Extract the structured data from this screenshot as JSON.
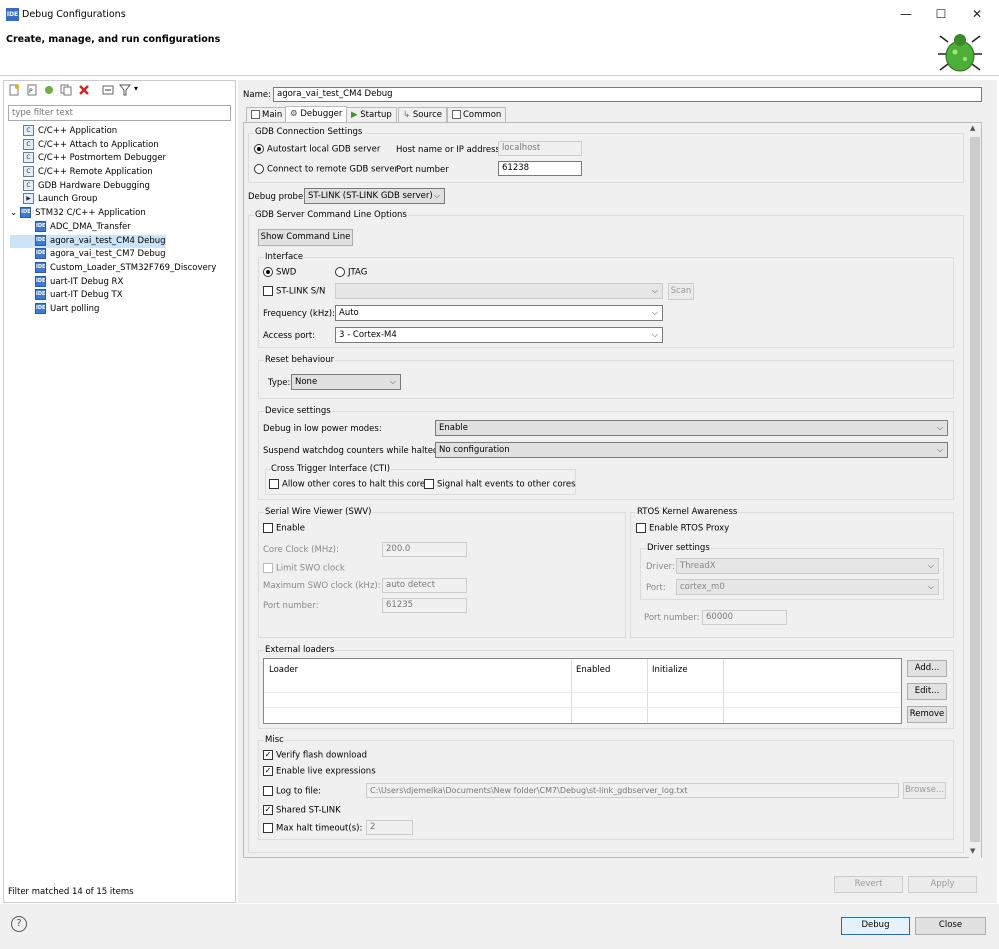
{
  "window": {
    "title": "Debug Configurations",
    "minimize": "—",
    "maximize": "☐",
    "close": "✕"
  },
  "header": {
    "title": "Create, manage, and run configurations"
  },
  "left": {
    "filter_placeholder": "type filter text",
    "tree": [
      {
        "label": "C/C++ Application",
        "level": 1,
        "icon": "c"
      },
      {
        "label": "C/C++ Attach to Application",
        "level": 1,
        "icon": "c"
      },
      {
        "label": "C/C++ Postmortem Debugger",
        "level": 1,
        "icon": "c"
      },
      {
        "label": "C/C++ Remote Application",
        "level": 1,
        "icon": "c"
      },
      {
        "label": "GDB Hardware Debugging",
        "level": 1,
        "icon": "c"
      },
      {
        "label": "Launch Group",
        "level": 1,
        "icon": "launch"
      },
      {
        "label": "STM32 C/C++ Application",
        "level": 0,
        "icon": "ide"
      },
      {
        "label": "ADC_DMA_Transfer",
        "level": 2,
        "icon": "ide"
      },
      {
        "label": "agora_vai_test_CM4 Debug",
        "level": 2,
        "icon": "ide"
      },
      {
        "label": "agora_vai_test_CM7 Debug",
        "level": 2,
        "icon": "ide"
      },
      {
        "label": "Custom_Loader_STM32F769_Discovery",
        "level": 2,
        "icon": "ide"
      },
      {
        "label": "uart-IT Debug RX",
        "level": 2,
        "icon": "ide"
      },
      {
        "label": "uart-IT Debug TX",
        "level": 2,
        "icon": "ide"
      },
      {
        "label": "Uart polling",
        "level": 2,
        "icon": "ide"
      }
    ],
    "status": "Filter matched 14 of 15 items"
  },
  "name_label": "Name:",
  "name_value": "agora_vai_test_CM4 Debug",
  "tabs": [
    "Main",
    "Debugger",
    "Startup",
    "Source",
    "Common"
  ],
  "gdb": {
    "group": "GDB Connection Settings",
    "autostart": "Autostart local GDB server",
    "remote": "Connect to remote GDB server",
    "host_label": "Host name or IP address",
    "host_value": "localhost",
    "port_label": "Port number",
    "port_value": "61238"
  },
  "probe": {
    "label": "Debug probe",
    "value": "ST-LINK (ST-LINK GDB server)"
  },
  "server": {
    "group": "GDB Server Command Line Options",
    "show_cmd": "Show Command Line"
  },
  "interface": {
    "group": "Interface",
    "swd": "SWD",
    "jtag": "JTAG",
    "stlink_sn": "ST-LINK S/N",
    "scan": "Scan",
    "freq_label": "Frequency (kHz):",
    "freq_value": "Auto",
    "access_label": "Access port:",
    "access_value": "3 - Cortex-M4"
  },
  "reset": {
    "group": "Reset behaviour",
    "type_label": "Type:",
    "type_value": "None"
  },
  "device": {
    "group": "Device settings",
    "lowpower_label": "Debug in low power modes:",
    "lowpower_value": "Enable",
    "watchdog_label": "Suspend watchdog counters while halted:",
    "watchdog_value": "No configuration",
    "cti_group": "Cross Trigger Interface (CTI)",
    "cti_allow": "Allow other cores to halt this core",
    "cti_signal": "Signal halt events to other cores"
  },
  "swv": {
    "group": "Serial Wire Viewer (SWV)",
    "enable": "Enable",
    "core_clock_label": "Core Clock (MHz):",
    "core_clock_value": "200.0",
    "limit": "Limit SWO clock",
    "max_swo_label": "Maximum SWO clock (kHz):",
    "max_swo_value": "auto detect",
    "port_label": "Port number:",
    "port_value": "61235"
  },
  "rtos": {
    "group": "RTOS Kernel Awareness",
    "enable": "Enable RTOS Proxy",
    "driver_group": "Driver settings",
    "driver_label": "Driver:",
    "driver_value": "ThreadX",
    "port_label": "Port:",
    "port_value": "cortex_m0",
    "portnum_label": "Port number:",
    "portnum_value": "60000"
  },
  "loaders": {
    "group": "External loaders",
    "columns": [
      "Loader",
      "Enabled",
      "Initialize"
    ],
    "add": "Add...",
    "edit": "Edit...",
    "remove": "Remove"
  },
  "misc": {
    "group": "Misc",
    "verify": "Verify flash download",
    "live": "Enable live expressions",
    "log_label": "Log to file:",
    "log_value": "C:\\Users\\djemelka\\Documents\\New folder\\CM7\\Debug\\st-link_gdbserver_log.txt",
    "browse": "Browse...",
    "shared": "Shared ST-LINK",
    "maxhalt_label": "Max halt timeout(s):",
    "maxhalt_value": "2"
  },
  "actions": {
    "revert": "Revert",
    "apply": "Apply",
    "debug": "Debug",
    "close": "Close",
    "help": "?"
  }
}
